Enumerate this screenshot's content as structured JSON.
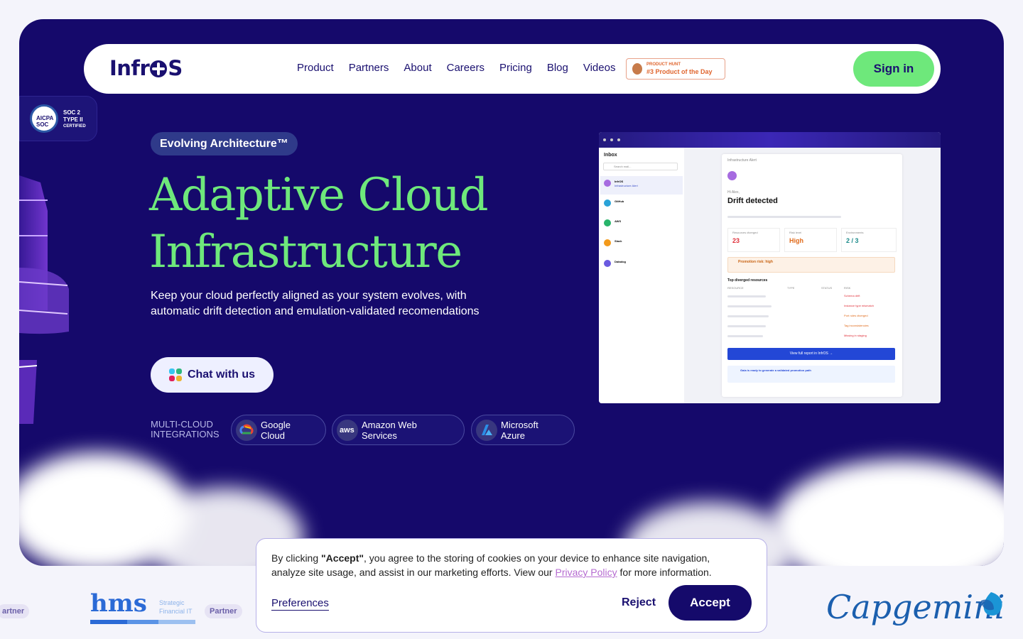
{
  "brand": {
    "logo": "InfrOS"
  },
  "nav": {
    "links": [
      "Product",
      "Partners",
      "About",
      "Careers",
      "Pricing",
      "Blog",
      "Videos"
    ],
    "product_hunt": {
      "line1": "PRODUCT HUNT",
      "line2": "#3 Product of the Day"
    },
    "signin": "Sign in"
  },
  "soc_badge": {
    "seal": "AICPA SOC",
    "line1": "SOC 2",
    "line2": "TYPE II",
    "line3": "CERTIFIED"
  },
  "hero": {
    "pill": "Evolving Architecture™",
    "title_line1": "Adaptive Cloud",
    "title_line2": "Infrastructure",
    "subtitle": "Keep your cloud perfectly aligned as your system evolves, with automatic drift detection and emulation-validated recomendations",
    "chat_button": "Chat with us",
    "integrations_label_1": "MULTI-CLOUD",
    "integrations_label_2": "INTEGRATIONS",
    "integrations": [
      {
        "line1": "Google",
        "line2": "Cloud",
        "icon": "google-cloud-icon"
      },
      {
        "line1": "Amazon Web",
        "line2": "Services",
        "icon": "aws-icon"
      },
      {
        "line1": "Microsoft",
        "line2": "Azure",
        "icon": "azure-icon"
      }
    ]
  },
  "mock_app": {
    "sidebar_title": "Inbox",
    "search_placeholder": "Search mail...",
    "mail_senders": [
      "InfrOS",
      "GitHub",
      "AWS",
      "Slack",
      "Datadog"
    ],
    "mail_subject_first": "Infrastructure Alert",
    "header_label": "Infrastructure Alert",
    "greeting": "Hi Alex,",
    "headline": "Drift detected",
    "stats": [
      {
        "label": "Resources diverged",
        "value": "23",
        "color": "#e0303a"
      },
      {
        "label": "Risk level",
        "value": "High",
        "color": "#e06a1a"
      },
      {
        "label": "Environments",
        "value": "2 / 3",
        "color": "#1a8a8a"
      }
    ],
    "warning": "Promotion risk: high",
    "table_title": "Top diverged resources",
    "table_headers": [
      "RESOURCE",
      "TYPE",
      "STATUS",
      "RISK"
    ],
    "table_risks": [
      "Schema drift",
      "Instance type mismatch",
      "Port rules diverged",
      "Tag inconsistencies",
      "Missing in staging"
    ],
    "cta": "View full report in InfrOS →",
    "footer_note": "Gaia is ready to generate a validated promotion path"
  },
  "cookie": {
    "text_before": "By clicking ",
    "text_accept_word": "\"Accept\"",
    "text_middle": ", you agree to the storing of cookies on your device to enhance site navigation, analyze site usage, and assist in our marketing efforts. View our ",
    "privacy_link": "Privacy Policy",
    "text_after": " for more information.",
    "preferences": "Preferences",
    "reject": "Reject",
    "accept": "Accept"
  },
  "partners": {
    "left_tag": "artner",
    "hms_name": "hms",
    "hms_tagline_1": "Strategic",
    "hms_tagline_2": "Financial IT",
    "partner_tag": "Partner",
    "capgemini": "Capgemini"
  }
}
